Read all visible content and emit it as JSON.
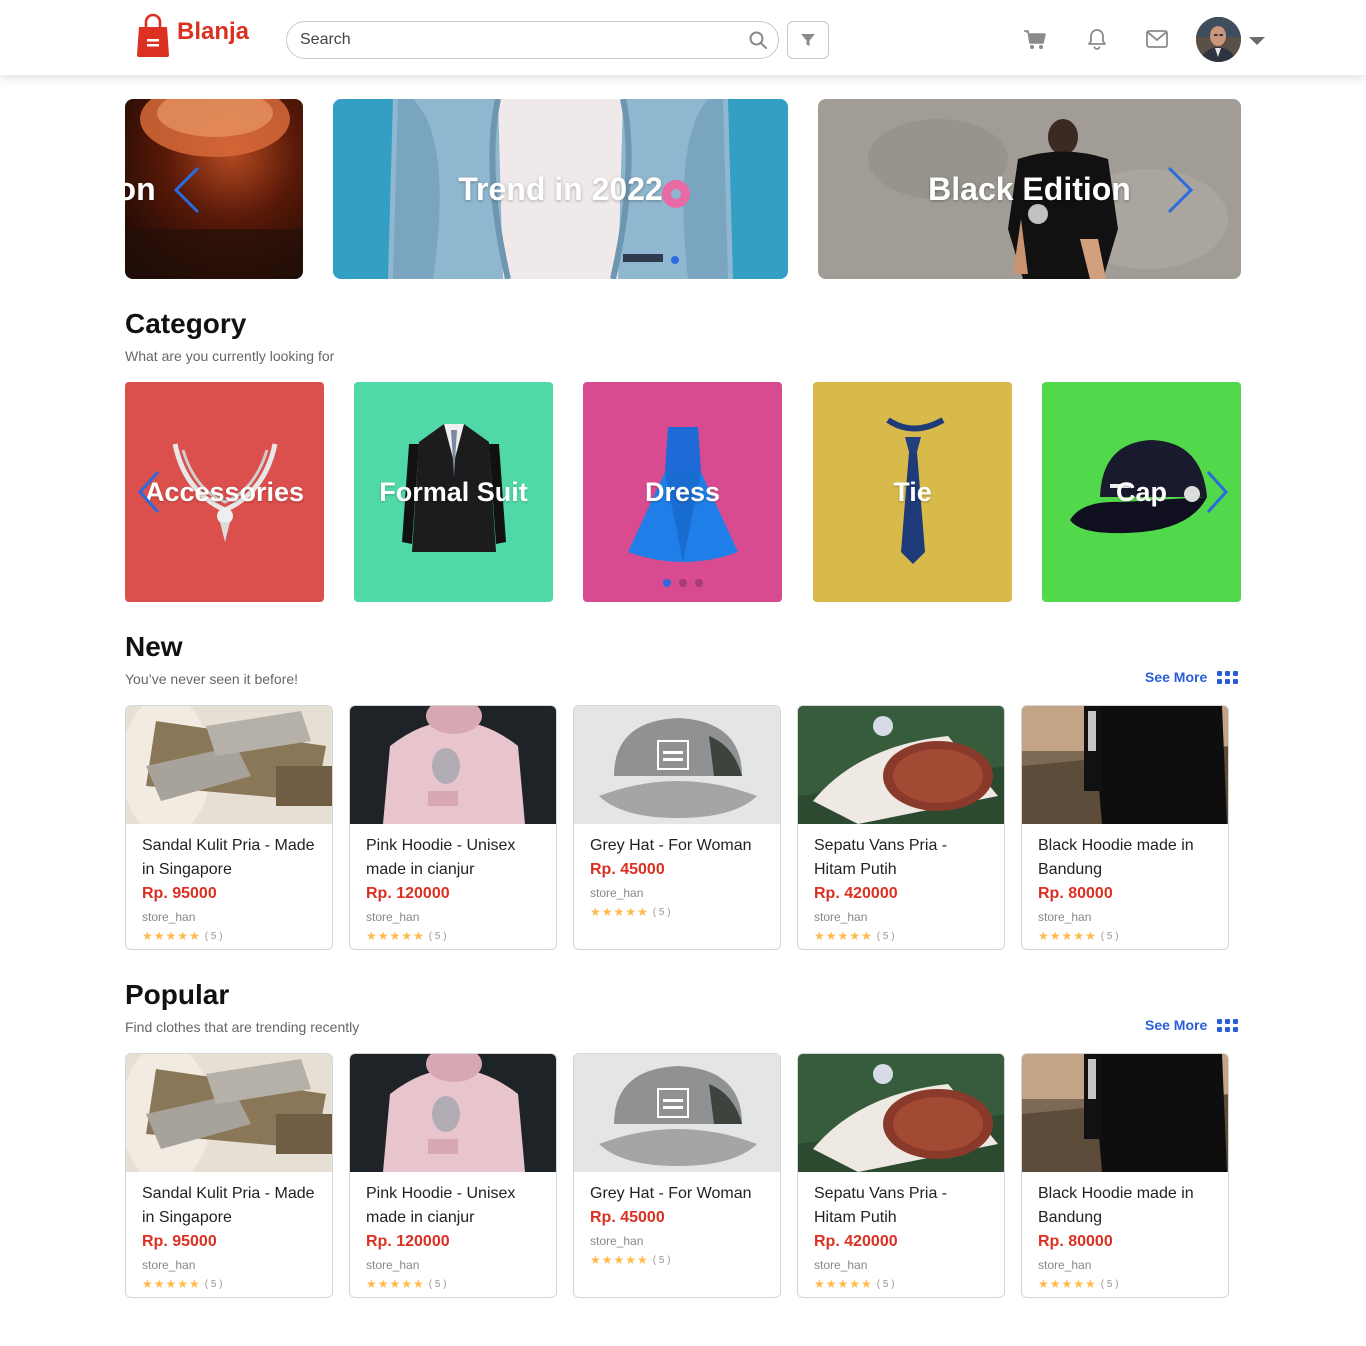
{
  "brand": {
    "name": "Blanja",
    "color": "#DB3022"
  },
  "search": {
    "placeholder": "Search"
  },
  "nav_icons": [
    "cart-icon",
    "bell-icon",
    "mail-icon"
  ],
  "banners": [
    {
      "label": "tion"
    },
    {
      "label": "Trend in 2022"
    },
    {
      "label": "Black Edition"
    }
  ],
  "category": {
    "title": "Category",
    "subtitle": "What are you currently looking for",
    "items": [
      {
        "label": "Accessories",
        "color": "#DB4F4C"
      },
      {
        "label": "Formal Suit",
        "color": "#50D9A7"
      },
      {
        "label": "Dress",
        "color": "#D84B90"
      },
      {
        "label": "Tie",
        "color": "#D8BA4B"
      },
      {
        "label": "Cap",
        "color": "#52D84B"
      }
    ]
  },
  "new_section": {
    "title": "New",
    "subtitle": "You’ve never seen it before!",
    "see_more": "See More"
  },
  "popular_section": {
    "title": "Popular",
    "subtitle": "Find clothes that are trending recently",
    "see_more": "See More"
  },
  "products": [
    {
      "name": "Sandal Kulit Pria - Made in Singapore",
      "price": "Rp. 95000",
      "store": "store_han",
      "rating": "( 5 )"
    },
    {
      "name": "Pink Hoodie - Unisex made in cianjur",
      "price": "Rp. 120000",
      "store": "store_han",
      "rating": "( 5 )"
    },
    {
      "name": "Grey Hat - For Woman",
      "price": "Rp. 45000",
      "store": "store_han",
      "rating": "( 5 )"
    },
    {
      "name": "Sepatu Vans Pria - Hitam Putih",
      "price": "Rp. 420000",
      "store": "store_han",
      "rating": "( 5 )"
    },
    {
      "name": "Black Hoodie made in Bandung",
      "price": "Rp. 80000",
      "store": "store_han",
      "rating": "( 5 )"
    }
  ]
}
